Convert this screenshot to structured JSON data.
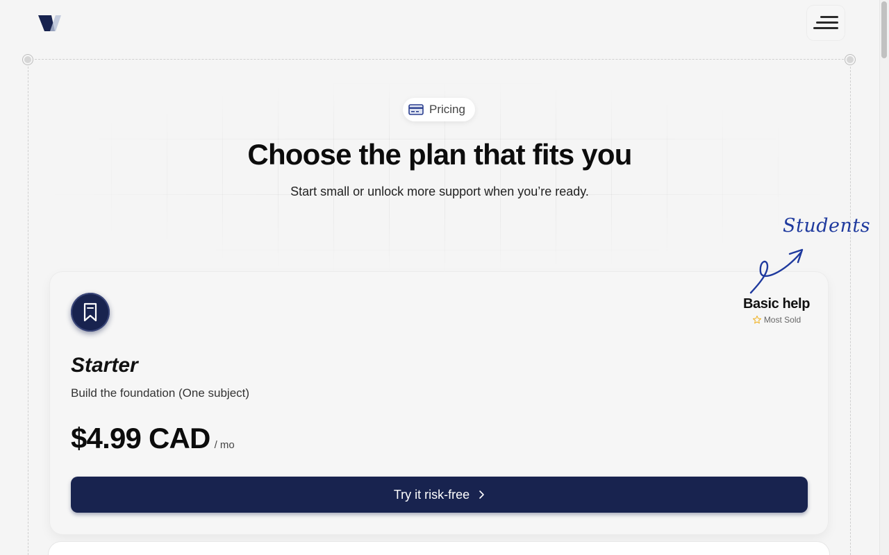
{
  "header": {
    "logo_icon": "logo-parallelogram-icon",
    "menu_icon": "hamburger-menu-icon"
  },
  "hero": {
    "badge_label": "Pricing",
    "badge_icon": "credit-card-icon",
    "title": "Choose the plan that fits you",
    "subtitle": "Start small or unlock more support when you’re ready."
  },
  "plan": {
    "icon": "bookmark-icon",
    "name": "Starter",
    "description": "Build the foundation (One subject)",
    "price": "$4.99 CAD",
    "period": "/ mo",
    "cta_label": "Try it risk-free",
    "cta_icon": "chevron-right-icon"
  },
  "callout": {
    "handwritten": "Students",
    "title": "Basic help",
    "subtitle": "Most Sold",
    "subtitle_icon": "star-outline-icon"
  },
  "colors": {
    "brand_navy": "#18234f",
    "accent_blue": "#1f3a9e",
    "background": "#f5f5f5",
    "star": "#f0b429"
  }
}
